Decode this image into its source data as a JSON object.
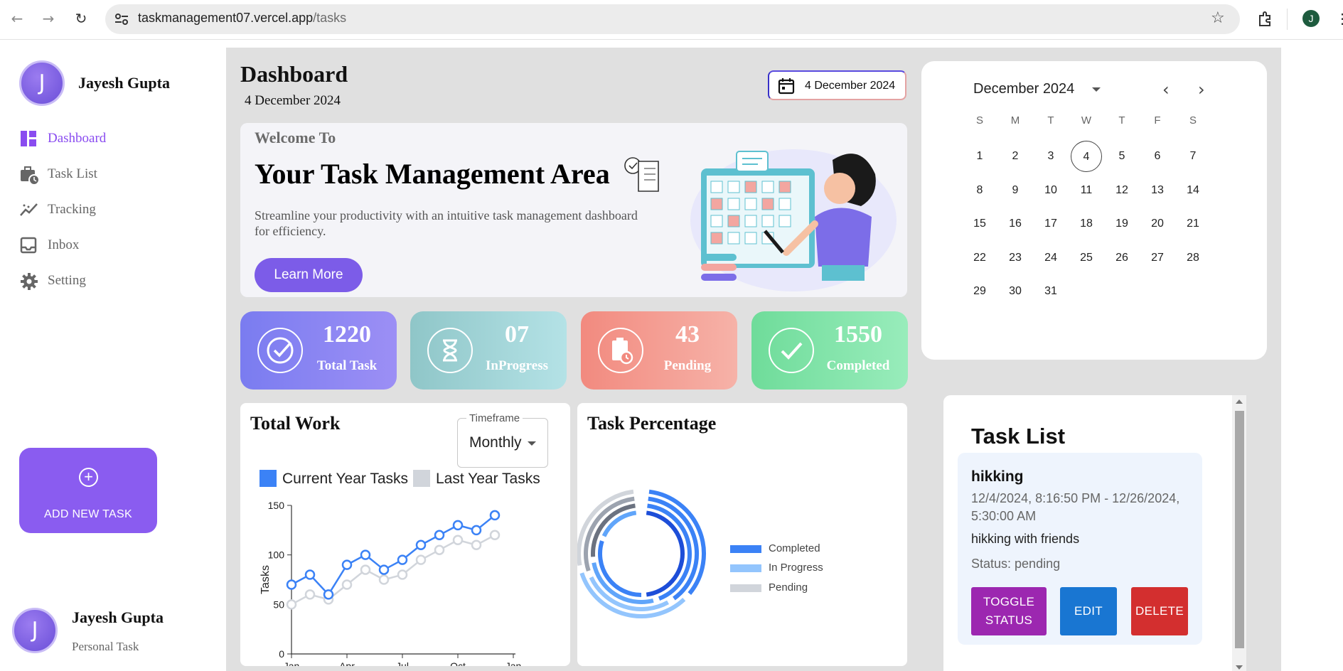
{
  "browser": {
    "url_host": "taskmanagement07.vercel.app",
    "url_path": "/tasks",
    "profile_initial": "J"
  },
  "sidebar": {
    "user": {
      "initial": "J",
      "name": "Jayesh Gupta"
    },
    "items": [
      {
        "label": "Dashboard",
        "icon": "dashboard-icon",
        "active": true
      },
      {
        "label": "Task List",
        "icon": "briefcase-clock-icon",
        "active": false
      },
      {
        "label": "Tracking",
        "icon": "trending-icon",
        "active": false
      },
      {
        "label": "Inbox",
        "icon": "inbox-icon",
        "active": false
      },
      {
        "label": "Setting",
        "icon": "gear-icon",
        "active": false
      }
    ],
    "add_task_label": "ADD NEW TASK",
    "footer_user": {
      "initial": "J",
      "name": "Jayesh Gupta",
      "role": "Personal Task"
    }
  },
  "header": {
    "title": "Dashboard",
    "date": "4 December 2024",
    "date_pill": "4 December 2024"
  },
  "welcome": {
    "subtitle": "Welcome To",
    "title": "Your Task Management Area",
    "description": "Streamline your productivity with an intuitive task management dashboard for efficiency.",
    "button": "Learn More"
  },
  "stats": [
    {
      "value": "1220",
      "label": "Total Task",
      "icon": "check-circle-icon",
      "gradient": [
        "#7a7cf0",
        "#9c8ff5"
      ]
    },
    {
      "value": "07",
      "label": "InProgress",
      "icon": "hourglass-icon",
      "gradient": [
        "#8fc6c8",
        "#b4e2e6"
      ]
    },
    {
      "value": "43",
      "label": "Pending",
      "icon": "clipboard-clock-icon",
      "gradient": [
        "#f28a7f",
        "#f6b2a8"
      ]
    },
    {
      "value": "1550",
      "label": "Completed",
      "icon": "check-icon",
      "gradient": [
        "#6fdc9a",
        "#98ecbb"
      ]
    }
  ],
  "total_work": {
    "title": "Total Work",
    "timeframe_label": "Timeframe",
    "timeframe_value": "Monthly",
    "legend": [
      {
        "label": "Current Year Tasks",
        "color": "#3b82f6"
      },
      {
        "label": "Last Year Tasks",
        "color": "#d1d5db"
      }
    ]
  },
  "chart_data": [
    {
      "type": "line",
      "title": "Total Work",
      "ylabel": "Tasks",
      "xlabel": "",
      "x_ticks": [
        "Jan",
        "Apr",
        "Jul",
        "Oct",
        "Jan"
      ],
      "ylim": [
        0,
        150
      ],
      "y_ticks": [
        0,
        50,
        100,
        150
      ],
      "series": [
        {
          "name": "Current Year Tasks",
          "color": "#3b82f6",
          "values": [
            70,
            80,
            60,
            90,
            100,
            85,
            95,
            110,
            120,
            130,
            125,
            140
          ]
        },
        {
          "name": "Last Year Tasks",
          "color": "#d1d5db",
          "values": [
            50,
            60,
            55,
            70,
            85,
            75,
            80,
            95,
            105,
            115,
            110,
            120
          ]
        }
      ]
    },
    {
      "type": "pie",
      "title": "Task Percentage",
      "categories": [
        "Completed",
        "In Progress",
        "Pending"
      ],
      "colors": [
        "#3b82f6",
        "#93c5fd",
        "#d1d5db"
      ]
    }
  ],
  "task_percentage": {
    "title": "Task Percentage",
    "legend": [
      {
        "label": "Completed",
        "color": "#3b82f6"
      },
      {
        "label": "In Progress",
        "color": "#93c5fd"
      },
      {
        "label": "Pending",
        "color": "#d1d5db"
      }
    ]
  },
  "calendar": {
    "month_label": "December 2024",
    "weekdays": [
      "S",
      "M",
      "T",
      "W",
      "T",
      "F",
      "S"
    ],
    "first_weekday": 0,
    "days": 31,
    "today": 4
  },
  "task_list": {
    "title": "Task List",
    "tasks": [
      {
        "name": "hikking",
        "dates": "12/4/2024, 8:16:50 PM - 12/26/2024, 5:30:00 AM",
        "description": "hikking with friends",
        "status": "Status: pending",
        "buttons": {
          "toggle": "TOGGLE STATUS",
          "edit": "EDIT",
          "delete": "DELETE"
        }
      }
    ]
  }
}
